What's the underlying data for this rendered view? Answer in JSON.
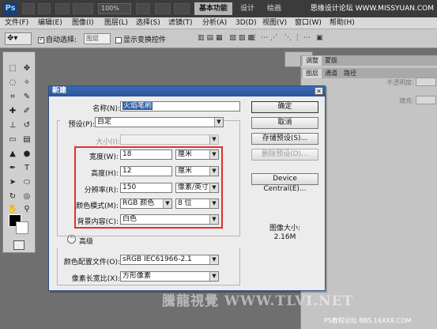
{
  "titlebar": {
    "app_icon": "Ps",
    "zoom": "100%",
    "workspaces": [
      "基本功能",
      "设计",
      "绘画"
    ],
    "watermark": "思缘设计论坛 WWW.MISSYUAN.COM"
  },
  "menu": [
    "文件(F)",
    "编辑(E)",
    "图像(I)",
    "图层(L)",
    "选择(S)",
    "滤镜(T)",
    "分析(A)",
    "3D(D)",
    "视图(V)",
    "窗口(W)",
    "帮助(H)"
  ],
  "options": {
    "auto_select_label": "自动选择:",
    "auto_select_value": "图层",
    "show_transform_label": "显示变换控件"
  },
  "panels": {
    "tabs_top": [
      "调整",
      "蒙版"
    ],
    "tabs_layers": [
      "图层",
      "通道",
      "路径"
    ],
    "opacity_label": "不透明度:",
    "fill_label": "填充:"
  },
  "dialog": {
    "title": "新建",
    "name_label": "名称(N):",
    "name_value": "火焰笔刷",
    "preset_label": "预设(P):",
    "preset_value": "自定",
    "size_label": "大小(I):",
    "width_label": "宽度(W):",
    "width_value": "18",
    "width_unit": "厘米",
    "height_label": "高度(H):",
    "height_value": "12",
    "height_unit": "厘米",
    "resolution_label": "分辨率(R):",
    "resolution_value": "150",
    "resolution_unit": "像素/英寸",
    "color_mode_label": "颜色模式(M):",
    "color_mode_value": "RGB 颜色",
    "bit_depth_value": "8 位",
    "bg_label": "背景内容(C):",
    "bg_value": "白色",
    "advanced_label": "高级",
    "color_profile_label": "颜色配置文件(O):",
    "color_profile_value": "sRGB IEC61966-2.1",
    "pixel_aspect_label": "像素长宽比(X):",
    "pixel_aspect_value": "方形像素",
    "buttons": {
      "ok": "确定",
      "cancel": "取消",
      "save_preset": "存储预设(S)...",
      "delete_preset": "删除预设(D)...",
      "device_central": "Device Central(E)..."
    },
    "image_size_label": "图像大小:",
    "image_size_value": "2.16M"
  },
  "canvas_watermark": "騰龍視覺 WWW.TLVI.NET",
  "bottom_watermark": "PS教程论坛 BBS.16XX8.COM"
}
